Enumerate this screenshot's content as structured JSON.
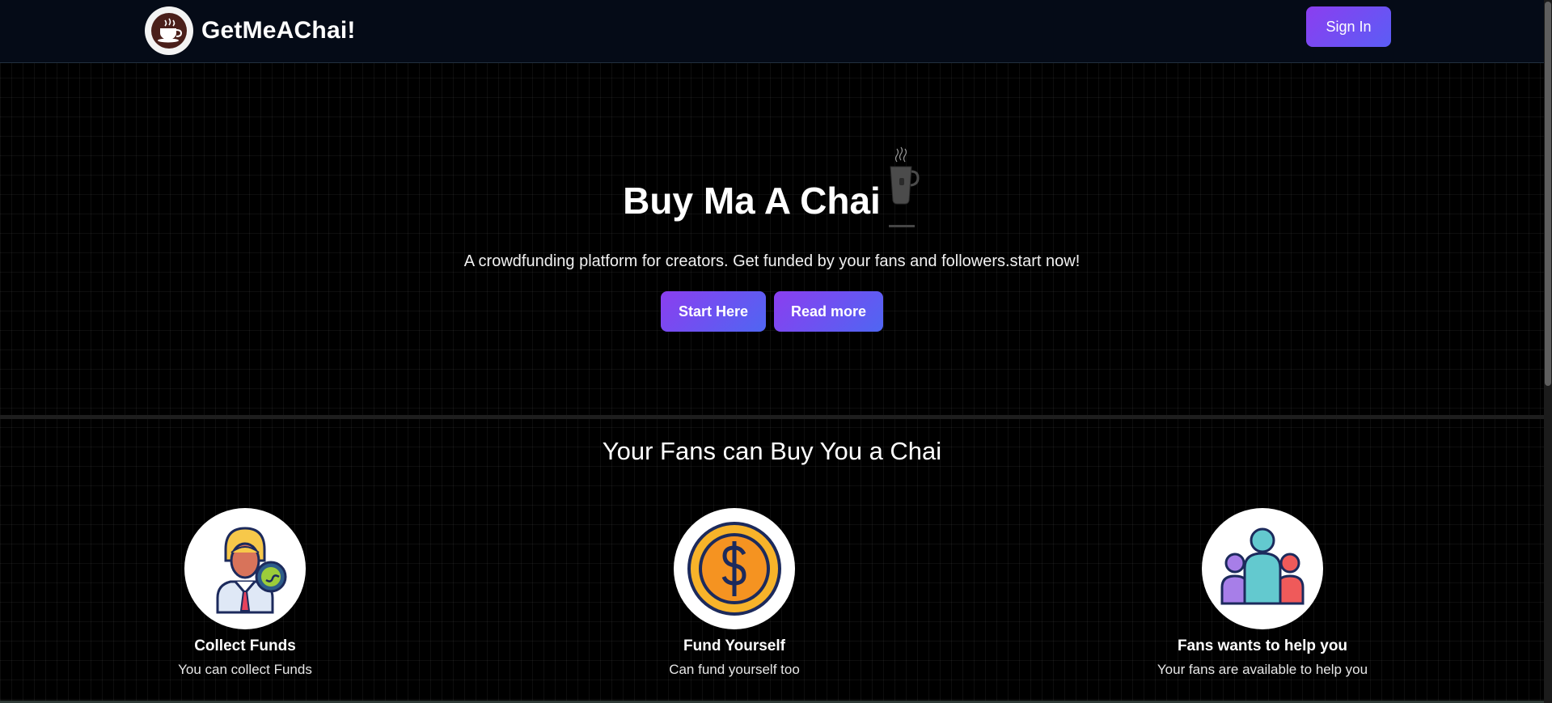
{
  "navbar": {
    "brand_name": "GetMeAChai!",
    "logo_icon": "chai-cup-logo-icon",
    "sign_in_label": "Sign In"
  },
  "hero": {
    "title": "Buy Ma A Chai",
    "title_icon": "chai-glass-icon",
    "subtitle": "A crowdfunding platform for creators. Get funded by your fans and followers.start now!",
    "start_label": "Start Here",
    "read_label": "Read more"
  },
  "section": {
    "title": "Your Fans can Buy You a Chai",
    "features": [
      {
        "icon": "person-with-money-icon",
        "title": "Collect Funds",
        "desc": "You can collect Funds"
      },
      {
        "icon": "dollar-coin-icon",
        "title": "Fund Yourself",
        "desc": "Can fund yourself too"
      },
      {
        "icon": "group-people-icon",
        "title": "Fans wants to help you",
        "desc": "Your fans are available to help you"
      }
    ]
  },
  "colors": {
    "background": "#000000",
    "navbar": "#050b17",
    "button_gradient_start": "#8b3ef0",
    "button_gradient_end": "#4f66f2"
  }
}
